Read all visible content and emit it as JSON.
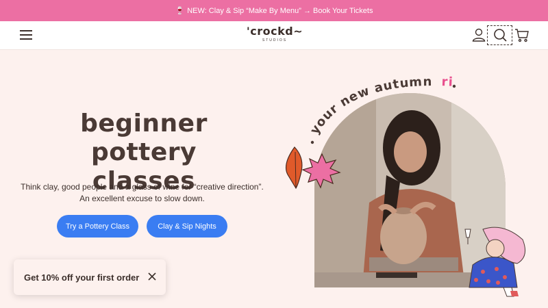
{
  "announcement": {
    "glass_icon": "wine-glass-icon",
    "text": "NEW: Clay & Sip “Make By Menu” → Book Your Tickets"
  },
  "header": {
    "menu_icon": "hamburger-icon",
    "logo_text": "'crockd~",
    "logo_sub": "STUDIOS",
    "icons": [
      "user-icon",
      "search-icon",
      "cart-icon"
    ]
  },
  "hero": {
    "title_line1": "beginner pottery",
    "title_line2": "classes",
    "desc_line1": "Think clay, good people and a glass of wine for “creative direction”.",
    "desc_line2": "An excellent excuse to slow down.",
    "btn_try": "Try a Pottery Class",
    "btn_sip": "Clay & Sip Nights",
    "curve_text": "your new autumn",
    "curve_accent": "ritual"
  },
  "promo": {
    "text": "Get 10% off your first order",
    "close_icon": "close-icon"
  },
  "colors": {
    "announce_bg": "#ec6fa3",
    "button_bg": "#3a7df2",
    "page_bg": "#fdf1ee",
    "accent_pink": "#e8508e"
  }
}
